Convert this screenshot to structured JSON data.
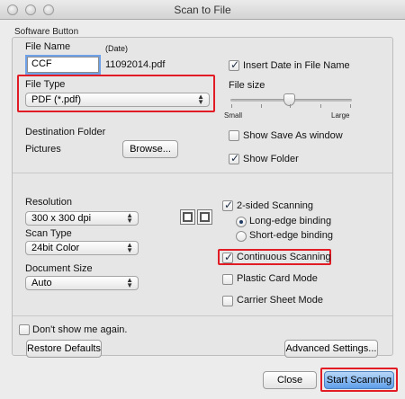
{
  "window": {
    "title": "Scan to File"
  },
  "tab": {
    "label": "Software Button"
  },
  "file": {
    "name_label": "File Name",
    "date_label": "(Date)",
    "name_value": "CCF",
    "name_suffix": "11092014.pdf",
    "type_label": "File Type",
    "type_value": "PDF (*.pdf)",
    "insert_date_label": "Insert Date in File Name",
    "insert_date_checked": true,
    "size_label": "File size",
    "size_min_label": "Small",
    "size_max_label": "Large",
    "size_level_percent": 50
  },
  "destination": {
    "label": "Destination Folder",
    "value": "Pictures",
    "browse_label": "Browse...",
    "show_save_as_label": "Show Save As window",
    "show_save_as_checked": false,
    "show_folder_label": "Show Folder",
    "show_folder_checked": true
  },
  "scan": {
    "resolution_label": "Resolution",
    "resolution_value": "300 x 300 dpi",
    "type_label": "Scan Type",
    "type_value": "24bit Color",
    "doc_size_label": "Document Size",
    "doc_size_value": "Auto",
    "two_sided_label": "2-sided Scanning",
    "two_sided_checked": true,
    "long_edge_label": "Long-edge binding",
    "long_edge_selected": true,
    "short_edge_label": "Short-edge binding",
    "short_edge_selected": false,
    "continuous_label": "Continuous Scanning",
    "continuous_checked": true,
    "plastic_label": "Plastic Card Mode",
    "plastic_checked": false,
    "carrier_label": "Carrier Sheet Mode",
    "carrier_checked": false
  },
  "footer": {
    "dont_show_label": "Don't show me again.",
    "dont_show_checked": false,
    "restore_label": "Restore Defaults",
    "advanced_label": "Advanced Settings...",
    "close_label": "Close",
    "start_label": "Start Scanning"
  },
  "colors": {
    "highlight": "#e21b24",
    "default_button": "#5e9ee9",
    "focus_ring": "#6fa1e8"
  }
}
